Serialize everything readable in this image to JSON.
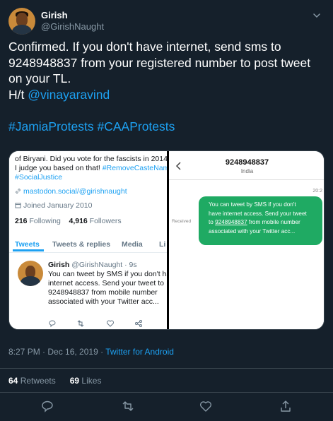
{
  "tweet": {
    "author_name": "Girish",
    "author_handle": "@GirishNaught",
    "text_line1": "Confirmed. If you don't have internet, send sms to",
    "text_line2": "9248948837 from your registered number to post tweet",
    "text_line3": "on your TL.",
    "text_ht": "H/t ",
    "mention": "@vinayaravind",
    "hashtag1": "#JamiaProtests",
    "hashtag2": "#CAAProtests",
    "timestamp": "8:27 PM · Dec 16, 2019",
    "dot": " · ",
    "source": "Twitter for Android",
    "retweets_count": "64",
    "retweets_label": " Retweets",
    "likes_count": "69",
    "likes_label": " Likes"
  },
  "left_shot": {
    "bio_line1": "of Biryani. Did you vote for the fascists in 2014",
    "bio_line2_a": "I judge you based on that! ",
    "bio_line2_b": "#RemoveCasteNam",
    "bio_line3": "#SocialJustice",
    "link": "mastodon.social/@girishnaught",
    "joined": "Joined January 2010",
    "following_count": "216",
    "following_label": " Following",
    "followers_count": "4,916",
    "followers_label": " Followers",
    "tabs": [
      "Tweets",
      "Tweets & replies",
      "Media",
      "Li"
    ],
    "mini_name": "Girish",
    "mini_handle": " @GirishNaught · 9s",
    "mini_line1": "You can tweet by SMS if you don't ha",
    "mini_line2": "internet access. Send your tweet to",
    "mini_line3": "9248948837 from mobile number",
    "mini_line4": "associated with your Twitter acc..."
  },
  "right_shot": {
    "number": "9248948837",
    "country": "India",
    "time": "20:2",
    "received_label": "Received",
    "bubble_line1": "You can tweet by SMS if you don't",
    "bubble_line2": "have internet access. Send your tweet",
    "bubble_line3a": "to ",
    "bubble_line3_number": "9248948837",
    "bubble_line3b": " from mobile number",
    "bubble_line4": "associated with your Twitter acc..."
  },
  "colors": {
    "background": "#15202b",
    "accent": "#1da1f2",
    "muted": "#8899a6",
    "sms_bubble": "#1faa63"
  },
  "icons": [
    "chevron-down-icon",
    "reply-icon",
    "retweet-icon",
    "like-icon",
    "share-icon",
    "link-icon",
    "calendar-icon",
    "back-arrow-icon"
  ]
}
